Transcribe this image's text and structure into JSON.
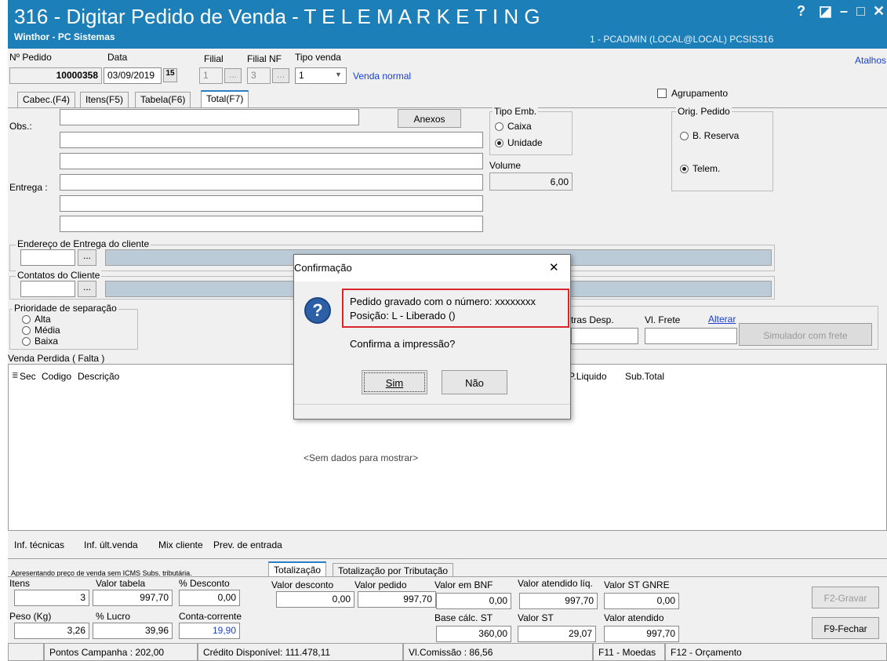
{
  "window": {
    "title": "316 - Digitar Pedido de Venda - T E L E M A R K E T I N G",
    "subtitle": "Winthor - PC Sistemas",
    "user_info": "1 - PCADMIN (LOCAL@LOCAL)  PCSIS316",
    "controls": {
      "help": "?",
      "restore": "◪",
      "minimize": "–",
      "maximize": "□",
      "close": "✕"
    }
  },
  "header": {
    "pedido_label": "Nº Pedido",
    "pedido_value": "10000358",
    "data_label": "Data",
    "data_value": "03/09/2019",
    "filial_label": "Filial",
    "filial_value": "1",
    "filial_nf_label": "Filial NF",
    "filial_nf_value": "3",
    "tipo_venda_label": "Tipo venda",
    "tipo_venda_value": "1",
    "tipo_venda_desc": "Venda normal",
    "atalhos": "Atalhos",
    "calendar_glyph": "15",
    "ellipsis": "..."
  },
  "tabs": [
    {
      "label": "Cabec.(F4)"
    },
    {
      "label": "Itens(F5)"
    },
    {
      "label": "Tabela(F6)"
    },
    {
      "label": "Total(F7)"
    }
  ],
  "agrupamento": "Agrupamento",
  "obs_label": "Obs.:",
  "anexos_button": "Anexos",
  "entrega_label": "Entrega :",
  "tipo_emb": {
    "title": "Tipo Emb.",
    "caixa": "Caixa",
    "unidade": "Unidade"
  },
  "volume": {
    "label": "Volume",
    "value": "6,00"
  },
  "orig_pedido": {
    "title": "Orig. Pedido",
    "reserva": "B. Reserva",
    "telem": "Telem."
  },
  "endereco_title": "Endereço de Entrega do cliente",
  "contatos_title": "Contatos do Cliente",
  "prioridade": {
    "title": "Prioridade de separação",
    "alta": "Alta",
    "media": "Média",
    "baixa": "Baixa"
  },
  "frete": {
    "outras_desp": "tras Desp.",
    "vl_frete": "Vl. Frete",
    "alterar": "Alterar",
    "simulador": "Simulador com frete"
  },
  "venda_perdida": "Venda Perdida ( Falta )",
  "grid": {
    "columns": [
      "Sec",
      "Codigo",
      "Descrição",
      "P.Liquido",
      "Sub.Total"
    ],
    "empty": "<Sem dados para mostrar>"
  },
  "bottom_links": [
    "Inf. técnicas",
    "Inf. últ.venda",
    "Mix cliente",
    "Prev. de entrada"
  ],
  "totais": {
    "notice": "Apresentando preço de venda sem ICMS Subs. tributária.",
    "tab_totalizacao": "Totalização",
    "tab_tributacao": "Totalização por Tributação",
    "itens_label": "Itens",
    "itens_value": "3",
    "valor_tabela_label": "Valor tabela",
    "valor_tabela_value": "997,70",
    "desconto_pct_label": "% Desconto",
    "desconto_pct_value": "0,00",
    "valor_desconto_label": "Valor desconto",
    "valor_desconto_value": "0,00",
    "valor_pedido_label": "Valor pedido",
    "valor_pedido_value": "997,70",
    "valor_bnf_label": "Valor em BNF",
    "valor_bnf_value": "0,00",
    "valor_atendido_liq_label": "Valor atendido líq.",
    "valor_atendido_liq_value": "997,70",
    "valor_st_gnre_label": "Valor ST GNRE",
    "valor_st_gnre_value": "0,00",
    "peso_label": "Peso (Kg)",
    "peso_value": "3,26",
    "lucro_label": "% Lucro",
    "lucro_value": "39,96",
    "conta_corrente_label": "Conta-corrente",
    "conta_corrente_value": "19,90",
    "base_st_label": "Base cálc. ST",
    "base_st_value": "360,00",
    "valor_st_label": "Valor ST",
    "valor_st_value": "29,07",
    "valor_atendido_label": "Valor atendido",
    "valor_atendido_value": "997,70"
  },
  "buttons": {
    "gravar": "F2-Gravar",
    "fechar": "F9-Fechar"
  },
  "status": {
    "pontos": "Pontos Campanha : 202,00",
    "credito": "Crédito Disponível: 111.478,11",
    "comissao": "Vl.Comissão : 86,56",
    "moedas": "F11 - Moedas",
    "orcamento": "F12 - Orçamento"
  },
  "dialog": {
    "title": "Confirmação",
    "close": "✕",
    "icon": "?",
    "line1": "Pedido gravado com o número: xxxxxxxx",
    "line2": "Posição: L - Liberado ()",
    "question": "Confirma a impressão?",
    "sim": "Sim",
    "nao": "Não"
  },
  "colors": {
    "titlebar": "#1c7fb8",
    "highlight": "#d9262c",
    "link": "#1a3fd1"
  }
}
